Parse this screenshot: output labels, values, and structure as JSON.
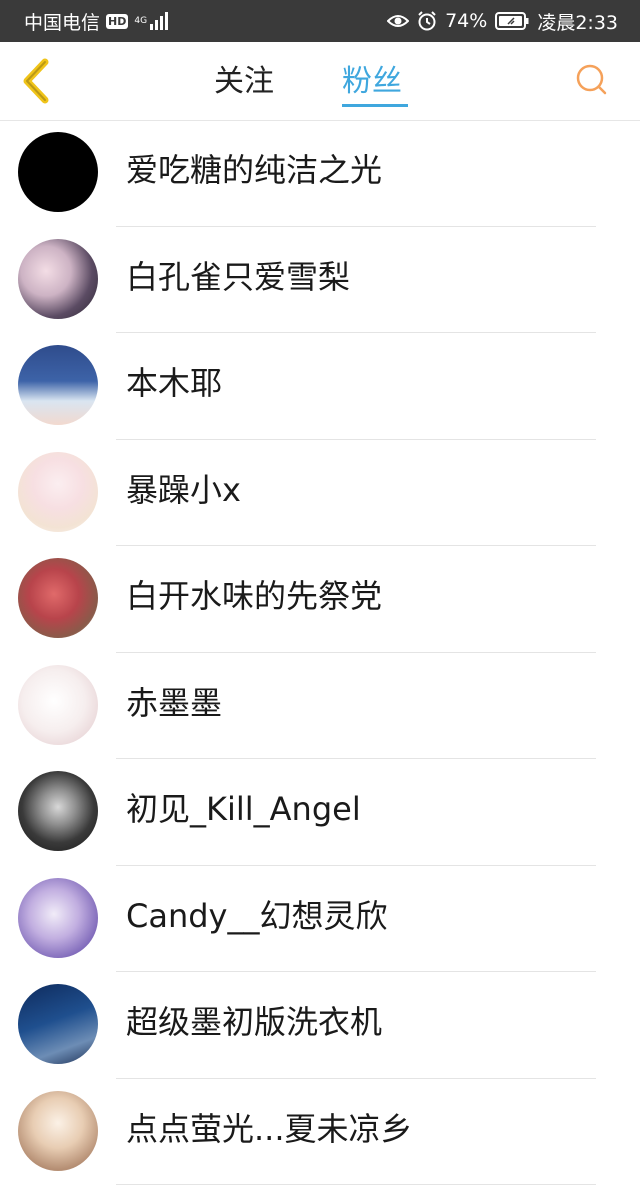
{
  "status_bar": {
    "carrier": "中国电信",
    "hd_badge": "HD",
    "network_type": "4G",
    "battery_percent": "74%",
    "time": "凌晨2:33",
    "icons": [
      "hd-icon",
      "signal-icon",
      "eye-icon",
      "alarm-icon",
      "battery-icon"
    ]
  },
  "header": {
    "back_icon": "chevron-left-icon",
    "tabs": [
      {
        "label": "关注",
        "active": false
      },
      {
        "label": "粉丝",
        "active": true
      }
    ],
    "search_icon": "search-icon",
    "accent_color": "#3fa7de",
    "back_color": "#f0c419",
    "search_color": "#f5a15a"
  },
  "fans_list": [
    {
      "name": "爱吃糖的纯洁之光",
      "avatar": "black"
    },
    {
      "name": "白孔雀只爱雪梨",
      "avatar": "anime-dark-lace"
    },
    {
      "name": "本木耶",
      "avatar": "anime-blue-hair"
    },
    {
      "name": "暴躁小x",
      "avatar": "anime-pink-bow"
    },
    {
      "name": "白开水味的先祭党",
      "avatar": "anime-red-hair"
    },
    {
      "name": "赤墨墨",
      "avatar": "anime-white-hair"
    },
    {
      "name": "初见_Kill_Angel",
      "avatar": "anime-dark-ornate"
    },
    {
      "name": "Candy__幻想灵欣",
      "avatar": "anime-purple-flowers"
    },
    {
      "name": "超级墨初版洗衣机",
      "avatar": "night-scene"
    },
    {
      "name": "点点萤光...夏未凉乡",
      "avatar": "anime-cream"
    }
  ]
}
